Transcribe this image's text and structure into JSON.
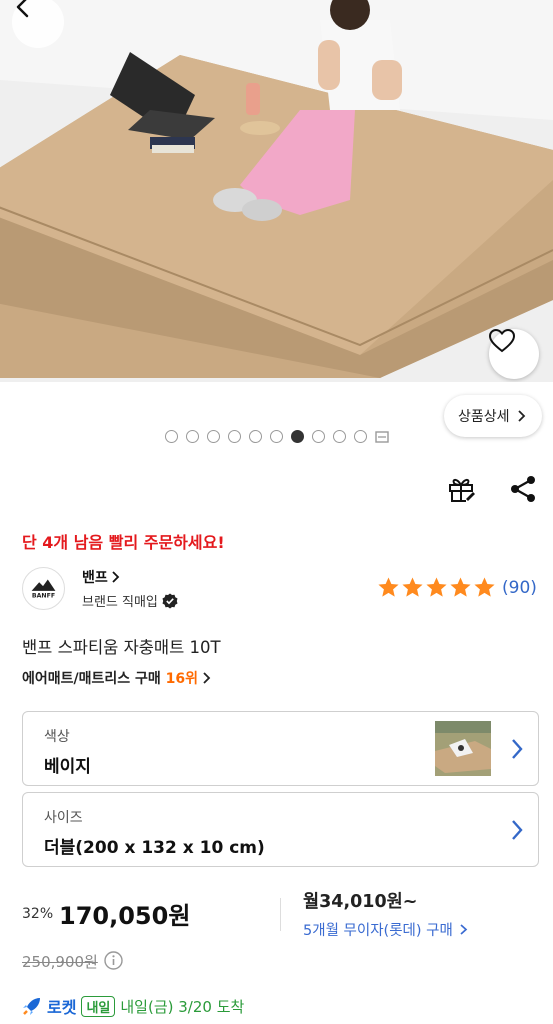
{
  "hero": {
    "image_alt": "product-photo-self-inflating-mat",
    "carousel": {
      "total": 10,
      "active_index": 6
    }
  },
  "nav": {
    "back_icon": "chevron-left-icon",
    "wish_icon": "heart-outline-icon"
  },
  "detail_button_label": "상품상세",
  "actions": {
    "gift_icon": "gift-icon",
    "share_icon": "share-icon"
  },
  "stock_notice": "단 4개 남음 빨리 주문하세요!",
  "brand": {
    "name": "밴프",
    "logo_text": "BANFF",
    "sub": "브랜드 직매입"
  },
  "rating": {
    "stars": 5,
    "count": "(90)"
  },
  "product_title": "밴프 스파티움 자충매트 10T",
  "ranking": {
    "category": "에어매트/매트리스 구매 ",
    "rank": "16위"
  },
  "options": [
    {
      "label": "색상",
      "value": "베이지"
    },
    {
      "label": "사이즈",
      "value": "더블(200 x 132 x 10 cm)"
    }
  ],
  "pricing": {
    "discount_rate": "32%",
    "sale_price": "170,050원",
    "monthly": "월34,010원~",
    "installment": "5개월 무이자(롯데) 구매",
    "original_price": "250,900원"
  },
  "delivery": {
    "rocket": "로켓",
    "badge": "내일",
    "arrival": "내일(금) 3/20 도착"
  },
  "colors": {
    "accent_red": "#e4191d",
    "link_blue": "#3468c8",
    "star": "#ff8a1e",
    "rank_orange": "#ff6a00",
    "rocket_blue": "#1a67d6",
    "arrival_green": "#2b9b3a"
  }
}
